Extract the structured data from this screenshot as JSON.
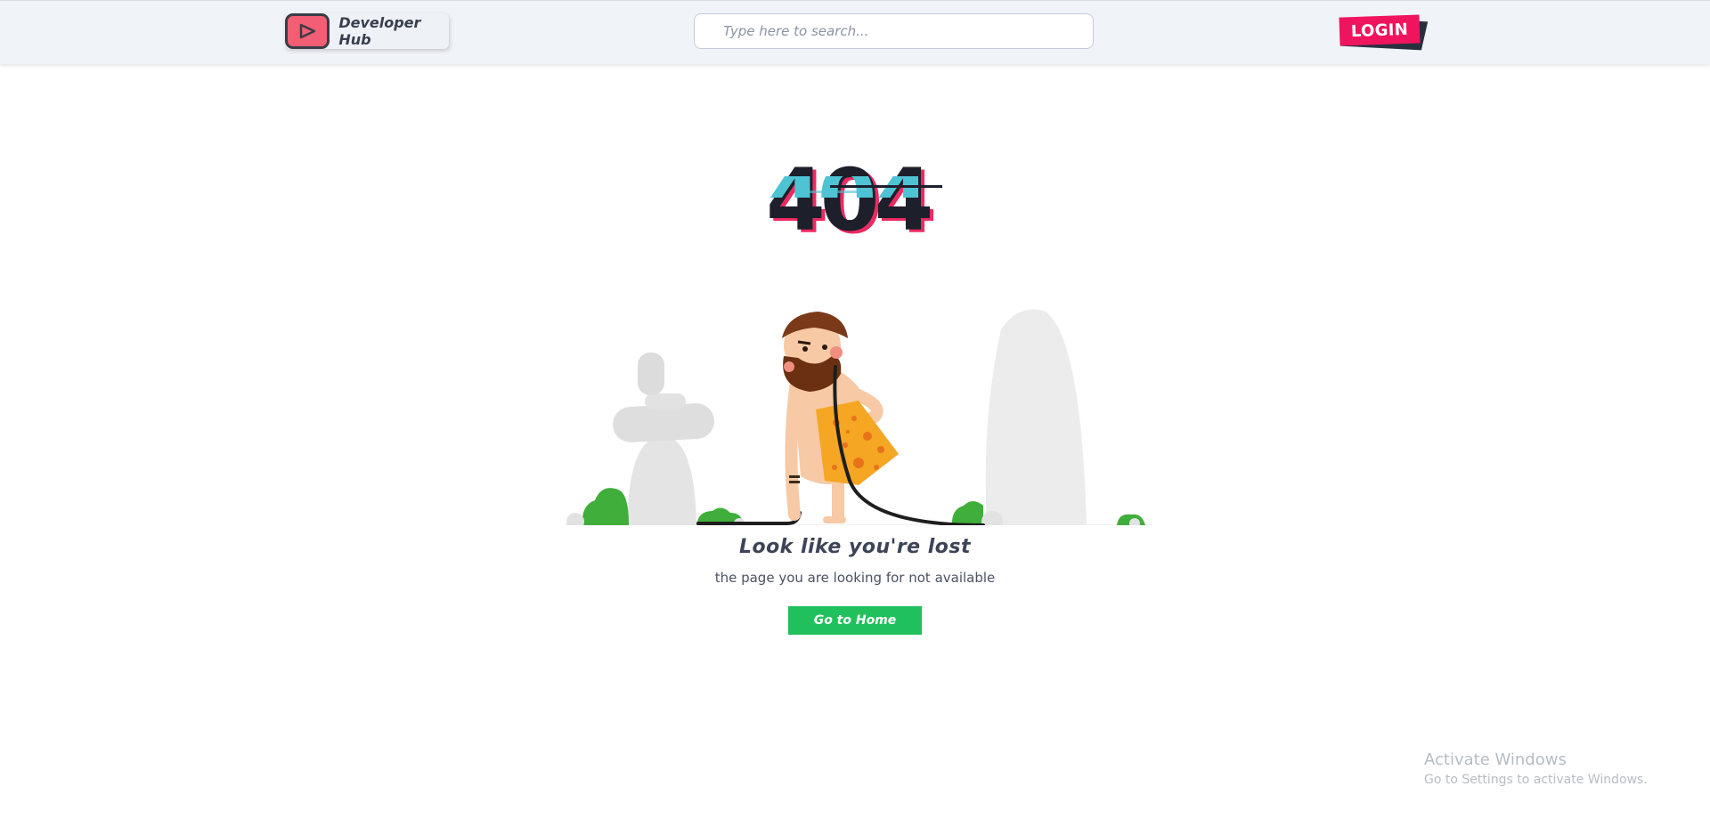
{
  "header": {
    "brand_name": "Developer Hub",
    "brand_icon": "play-icon",
    "search_placeholder": "Type here to search...",
    "login_label": "LOGIN"
  },
  "error": {
    "code": "404",
    "title": "Look like you're lost",
    "subtitle": "the page you are looking for not available",
    "home_button": "Go to Home"
  },
  "illustration": {
    "subject": "caveman holding unplugged cable"
  },
  "watermark": {
    "title": "Activate Windows",
    "subtitle": "Go to Settings to activate Windows."
  },
  "colors": {
    "accent_pink": "#f0145e",
    "brand_red": "#f25e74",
    "button_green": "#20c05c",
    "dark_text": "#1d1f2b"
  }
}
